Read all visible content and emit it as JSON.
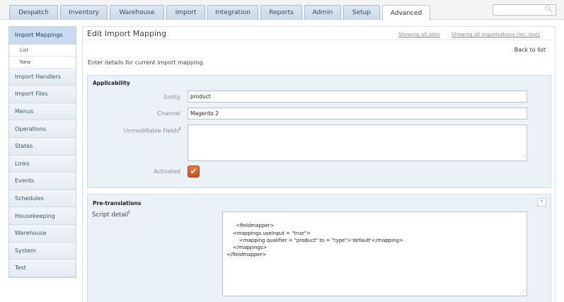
{
  "nav": {
    "tabs": [
      {
        "label": "Despatch",
        "active": false
      },
      {
        "label": "Inventory",
        "active": false
      },
      {
        "label": "Warehouse",
        "active": false
      },
      {
        "label": "Import",
        "active": false
      },
      {
        "label": "Integration",
        "active": false
      },
      {
        "label": "Reports",
        "active": false
      },
      {
        "label": "Admin",
        "active": false
      },
      {
        "label": "Setup",
        "active": false
      },
      {
        "label": "Advanced",
        "active": true
      }
    ],
    "search": {
      "value": "",
      "icon": "search-icon"
    }
  },
  "sidebar": {
    "items": [
      {
        "label": "Import Mappings",
        "active": true
      },
      {
        "label": "Import Handlers"
      },
      {
        "label": "Import Files"
      },
      {
        "label": "Menus"
      },
      {
        "label": "Operations"
      },
      {
        "label": "States"
      },
      {
        "label": "Links"
      },
      {
        "label": "Events"
      },
      {
        "label": "Schedules"
      },
      {
        "label": "Housekeeping"
      },
      {
        "label": "Warehouse"
      },
      {
        "label": "System"
      },
      {
        "label": "Test"
      }
    ],
    "subitems": [
      {
        "label": "List"
      },
      {
        "label": "New"
      }
    ]
  },
  "main": {
    "title": "Edit Import Mapping",
    "showing_sites": "Showing all sites",
    "showing_orgs": "Showing all organisations (inc. test)",
    "back_link": "Back to list",
    "intro": "Enter details for current import mapping."
  },
  "applicability": {
    "title": "Applicability",
    "entity_label": "Entity",
    "entity_value": "product",
    "channel_label": "Channel",
    "channel_value": "Magento 2",
    "unmodifiable_label": "Unmodifiable Fields",
    "unmodifiable_value": "",
    "activated_label": "Activated",
    "activated": true
  },
  "pretranslations": {
    "title": "Pre-translations",
    "collapse_glyph": "⌃",
    "script_label": "Script detail",
    "script_value": "<fieldmapper>\n    <mappings useInput = \"true\">\n        <mapping qualifier = \"product\" to = \"type\">'default'</mapping>\n    </mappings>\n</fieldmapper>"
  },
  "icons": {
    "info_glyph": "i",
    "grip_glyph": "⋰",
    "check_glyph": "✔"
  }
}
